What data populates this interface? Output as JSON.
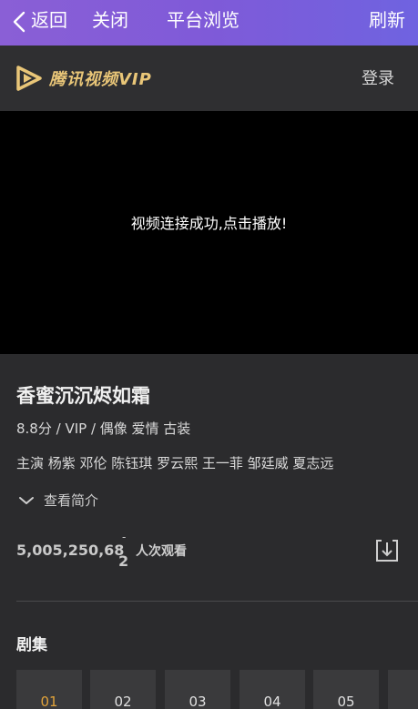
{
  "topbar": {
    "back_label": "返回",
    "close_label": "关闭",
    "platform_label": "平台浏览",
    "refresh_label": "刷新"
  },
  "header": {
    "logo_text": "腾讯视频VIP",
    "login_label": "登录"
  },
  "player": {
    "message": "视频连接成功,点击播放!"
  },
  "show": {
    "title": "香蜜沉沉烬如霜",
    "meta": "8.8分 / VIP / 偶像 爱情 古装",
    "cast": "主演 杨紫 邓伦 陈钰琪 罗云熙 王一菲 邹廷威 夏志远",
    "intro_label": "查看简介",
    "views_number": "5,005,250,68",
    "views_digit": "2",
    "views_tick": "-",
    "views_label": "人次观看"
  },
  "episodes": {
    "title": "剧集",
    "items": [
      "01",
      "02",
      "03",
      "04",
      "05",
      ""
    ],
    "active_index": 0
  },
  "colors": {
    "topbar_start": "#8a5fd6",
    "topbar_end": "#6f63e0",
    "logo_gold": "#e9c678",
    "active_episode": "#e0a23a"
  },
  "icons": [
    "back-chevron-icon",
    "tencent-video-logo-icon",
    "expand-chevron-icon",
    "download-icon"
  ]
}
